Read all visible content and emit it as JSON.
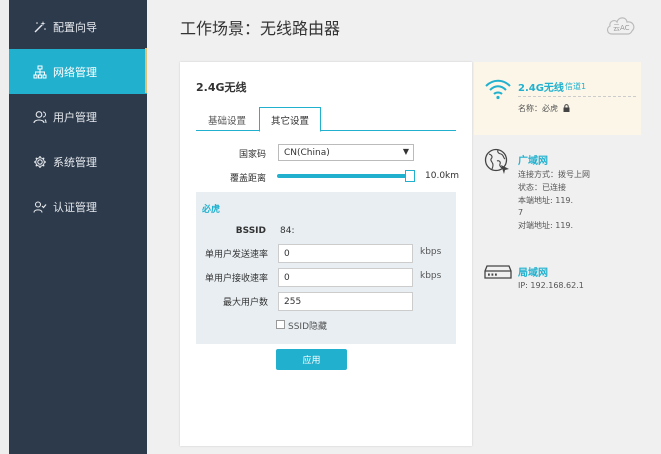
{
  "sidebar": {
    "items": [
      {
        "label": "配置向导",
        "icon": "magic-wand-icon"
      },
      {
        "label": "网络管理",
        "icon": "network-icon"
      },
      {
        "label": "用户管理",
        "icon": "users-icon"
      },
      {
        "label": "系统管理",
        "icon": "gear-icon"
      },
      {
        "label": "认证管理",
        "icon": "user-auth-icon"
      }
    ],
    "active_index": 1
  },
  "header": {
    "title": "工作场景：无线路由器",
    "cloud_label": "云AC"
  },
  "card": {
    "title": "2.4G无线",
    "tabs": [
      "基础设置",
      "其它设置"
    ],
    "active_tab": 1,
    "country_label": "国家码",
    "country_value": "CN(China)",
    "coverage_label": "覆盖距离",
    "coverage_value": "10.0km",
    "coverage_level": 1.0,
    "required_title": "必虎",
    "bssid_label": "BSSID",
    "bssid_value": "84:",
    "tx_label": "单用户发送速率",
    "tx_value": "0",
    "rx_label": "单用户接收速率",
    "rx_value": "0",
    "max_users_label": "最大用户数",
    "max_users_value": "255",
    "unit": "kbps",
    "ssid_hidden_label": "SSID隐藏",
    "ssid_hidden_checked": false,
    "apply_label": "应用"
  },
  "status": {
    "wifi_name": "2.4G无线",
    "wifi_channel": "信道1",
    "wifi_ssid_label": "名称：必虎",
    "wan_title": "广域网",
    "wan_lines": [
      "连接方式：拨号上网",
      "状态：已连接",
      "本端地址: 119.",
      "7",
      "对端地址: 119."
    ],
    "lan_title": "局域网",
    "lan_ip": "IP: 192.168.62.1"
  },
  "colors": {
    "accent": "#21b1cf",
    "sidebar_bg": "#2d3a4b",
    "highlight_bg": "#fbf6e8"
  }
}
